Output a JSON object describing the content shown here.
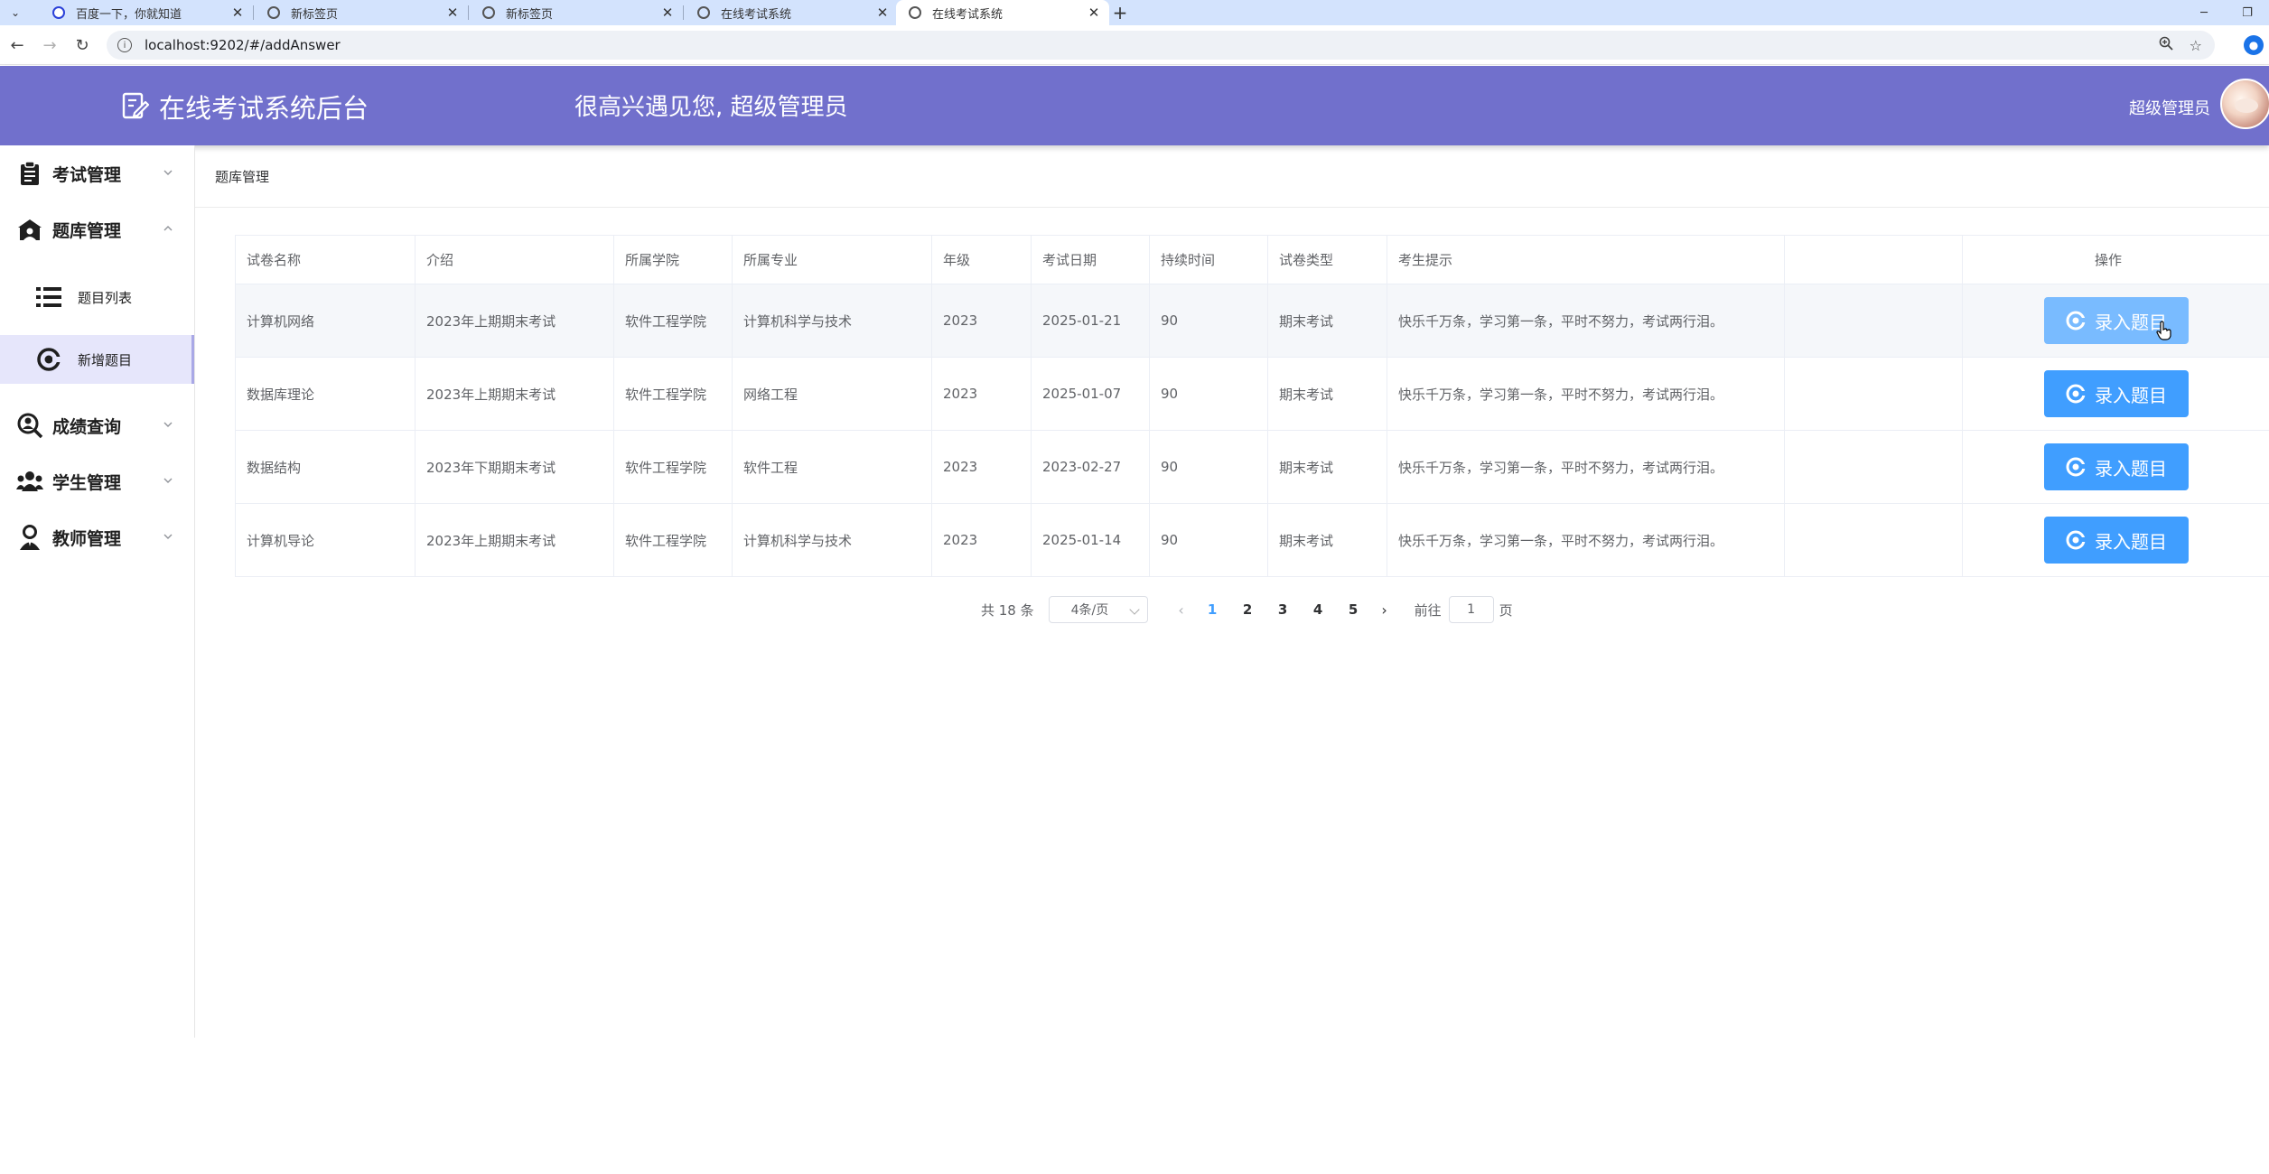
{
  "browser": {
    "tabs": [
      {
        "title": "百度一下，你就知道",
        "favicon": "baidu-icon",
        "active": false
      },
      {
        "title": "新标签页",
        "favicon": "chrome-icon",
        "active": false
      },
      {
        "title": "新标签页",
        "favicon": "chrome-icon",
        "active": false
      },
      {
        "title": "在线考试系统",
        "favicon": "globe-icon",
        "active": false
      },
      {
        "title": "在线考试系统",
        "favicon": "globe-icon",
        "active": true
      }
    ],
    "close_glyph": "✕",
    "new_tab_glyph": "+",
    "url": "localhost:9202/#/addAnswer"
  },
  "header": {
    "title": "在线考试系统后台",
    "welcome": "很高兴遇见您, 超级管理员",
    "user_name": "超级管理员",
    "bg_color": "#7170cc"
  },
  "sidebar": {
    "items": [
      {
        "label": "考试管理",
        "icon": "clipboard-icon",
        "expanded": false
      },
      {
        "label": "题库管理",
        "icon": "bank-icon",
        "expanded": true
      },
      {
        "label": "成绩查询",
        "icon": "search-person-icon",
        "expanded": false
      },
      {
        "label": "学生管理",
        "icon": "group-icon",
        "expanded": false
      },
      {
        "label": "教师管理",
        "icon": "teacher-icon",
        "expanded": false
      }
    ],
    "sub_items": [
      {
        "label": "题目列表",
        "icon": "list-icon",
        "active": false
      },
      {
        "label": "新增题目",
        "icon": "add-circle-icon",
        "active": true
      }
    ],
    "active_color": "#e6e6fb"
  },
  "breadcrumb": "题库管理",
  "table": {
    "columns": [
      "试卷名称",
      "介绍",
      "所属学院",
      "所属专业",
      "年级",
      "考试日期",
      "持续时间",
      "试卷类型",
      "考生提示",
      "",
      "操作"
    ],
    "rows": [
      {
        "name": "计算机网络",
        "intro": "2023年上期期末考试",
        "college": "软件工程学院",
        "major": "计算机科学与技术",
        "grade": "2023",
        "date": "2025-01-21",
        "duration": "90",
        "type": "期末考试",
        "tips": "快乐千万条，学习第一条，平时不努力，考试两行泪。",
        "action": "录入题目"
      },
      {
        "name": "数据库理论",
        "intro": "2023年上期期末考试",
        "college": "软件工程学院",
        "major": "网络工程",
        "grade": "2023",
        "date": "2025-01-07",
        "duration": "90",
        "type": "期末考试",
        "tips": "快乐千万条，学习第一条，平时不努力，考试两行泪。",
        "action": "录入题目"
      },
      {
        "name": "数据结构",
        "intro": "2023年下期期末考试",
        "college": "软件工程学院",
        "major": "软件工程",
        "grade": "2023",
        "date": "2023-02-27",
        "duration": "90",
        "type": "期末考试",
        "tips": "快乐千万条，学习第一条，平时不努力，考试两行泪。",
        "action": "录入题目"
      },
      {
        "name": "计算机导论",
        "intro": "2023年上期期末考试",
        "college": "软件工程学院",
        "major": "计算机科学与技术",
        "grade": "2023",
        "date": "2025-01-14",
        "duration": "90",
        "type": "期末考试",
        "tips": "快乐千万条，学习第一条，平时不努力，考试两行泪。",
        "action": "录入题目"
      }
    ],
    "button_color": "#409eff"
  },
  "pagination": {
    "total_text": "共 18 条",
    "page_size": "4条/页",
    "pages": [
      "1",
      "2",
      "3",
      "4",
      "5"
    ],
    "current": "1",
    "goto_label": "前往",
    "goto_value": "1",
    "goto_suffix": "页",
    "prev_glyph": "‹",
    "next_glyph": "›"
  }
}
